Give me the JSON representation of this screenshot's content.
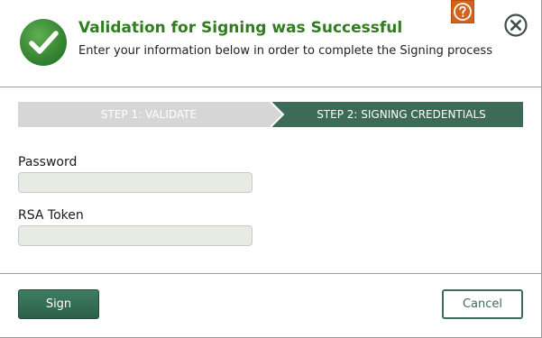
{
  "header": {
    "title": "Validation for Signing was Successful",
    "subtitle": "Enter your information below in order to complete the Signing process",
    "icons": {
      "success": "check-circle-icon",
      "help": "help-icon",
      "close": "close-icon"
    }
  },
  "steps": [
    {
      "label": "STEP 1: VALIDATE",
      "state": "completed"
    },
    {
      "label": "STEP 2: SIGNING CREDENTIALS",
      "state": "active"
    }
  ],
  "form": {
    "password": {
      "label": "Password",
      "value": "",
      "placeholder": ""
    },
    "rsa_token": {
      "label": "RSA Token",
      "value": "",
      "placeholder": ""
    }
  },
  "footer": {
    "sign_label": "Sign",
    "cancel_label": "Cancel"
  },
  "colors": {
    "title_green": "#2f7d1e",
    "step_active": "#3d6b57",
    "step_inactive": "#d9d9d9",
    "help_orange": "#d4621b",
    "check_green": "#3a8a3a"
  }
}
